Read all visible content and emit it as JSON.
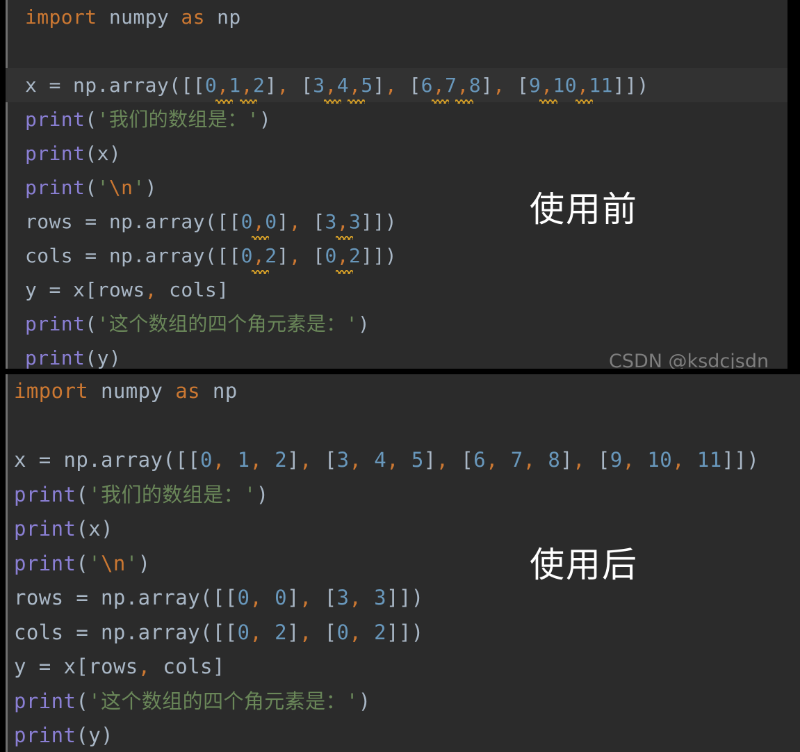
{
  "panels": [
    {
      "id": "before",
      "caption": "使用前",
      "style_note": "no space after commas, PEP8 warnings shown",
      "lines": [
        {
          "id": "l1",
          "text": "import numpy as np"
        },
        {
          "id": "l2",
          "text": ""
        },
        {
          "id": "l3",
          "text": "x = np.array([[0,1,2], [3,4,5], [6,7,8], [9,10,11]])",
          "current": true
        },
        {
          "id": "l4",
          "text": "print('我们的数组是：')"
        },
        {
          "id": "l5",
          "text": "print(x)"
        },
        {
          "id": "l6",
          "text": "print('\\n')"
        },
        {
          "id": "l7",
          "text": "rows = np.array([[0,0], [3,3]])"
        },
        {
          "id": "l8",
          "text": "cols = np.array([[0,2], [0,2]])"
        },
        {
          "id": "l9",
          "text": "y = x[rows, cols]"
        },
        {
          "id": "l10",
          "text": "print('这个数组的四个角元素是：')"
        },
        {
          "id": "l11",
          "text": "print(y)"
        }
      ]
    },
    {
      "id": "after",
      "caption": "使用后",
      "style_note": "space after every comma, no warnings",
      "lines": [
        {
          "id": "l1",
          "text": "import numpy as np"
        },
        {
          "id": "l2",
          "text": ""
        },
        {
          "id": "l3",
          "text": "x = np.array([[0, 1, 2], [3, 4, 5], [6, 7, 8], [9, 10, 11]])"
        },
        {
          "id": "l4",
          "text": "print('我们的数组是：')"
        },
        {
          "id": "l5",
          "text": "print(x)"
        },
        {
          "id": "l6",
          "text": "print('\\n')"
        },
        {
          "id": "l7",
          "text": "rows = np.array([[0, 0], [3, 3]])"
        },
        {
          "id": "l8",
          "text": "cols = np.array([[0, 2], [0, 2]])"
        },
        {
          "id": "l9",
          "text": "y = x[rows, cols]"
        },
        {
          "id": "l10",
          "text": "print('这个数组的四个角元素是：')"
        },
        {
          "id": "l11",
          "text": "print(y)"
        }
      ]
    }
  ],
  "tokens": {
    "kw_import": "import",
    "kw_as": "as",
    "mod_numpy": "numpy",
    "mod_np": "np",
    "fn_print": "print",
    "var_x": "x",
    "var_y": "y",
    "var_rows": "rows",
    "var_cols": "cols",
    "call_nparray": "np.array",
    "str_our_array": "我们的数组是：",
    "str_four_corners": "这个数组的四个角元素是：",
    "escape_newline": "\\n"
  },
  "watermark": {
    "text": "CSDN @ksdcjsdn"
  },
  "colors": {
    "editor_background": "#2b2b2b",
    "current_line_background": "#323232",
    "page_background": "#000000",
    "default_text": "#a9b7c6",
    "keyword": "#cc7832",
    "function": "#8a7fd4",
    "number": "#6897bb",
    "string": "#6a8759",
    "comma": "#cc7832",
    "warning_underline": "#d6a028",
    "caption_text": "#ffffff",
    "gutter_rule": "#6e6e6e"
  }
}
